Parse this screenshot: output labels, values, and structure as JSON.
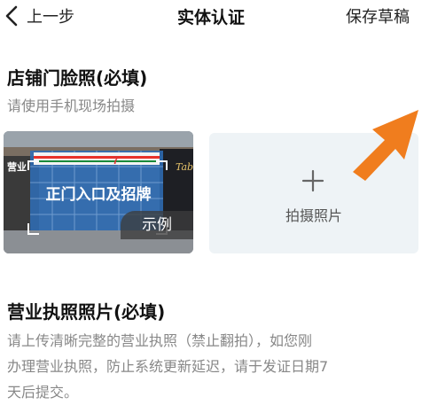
{
  "header": {
    "back_label": "上一步",
    "title": "实体认证",
    "save_draft": "保存草稿"
  },
  "storefront_section": {
    "title": "店铺门脸照(必填)",
    "subtitle": "请使用手机现场拍摄",
    "sample": {
      "caption": "正门入口及招牌",
      "tag": "示例",
      "sign_text": "营业",
      "sign_text_right": "Tab"
    },
    "upload": {
      "icon": "plus-icon",
      "label": "拍摄照片"
    }
  },
  "license_section": {
    "title": "营业执照照片(必填)",
    "description_lines": [
      "请上传清晰完整的营业执照（禁止翻拍），如您刚",
      "办理营业执照，防止系统更新延迟，请于发证日期7",
      "天后提交。"
    ]
  },
  "colors": {
    "annotation_arrow": "#f07d1e",
    "upload_bg": "#eef3f6"
  }
}
